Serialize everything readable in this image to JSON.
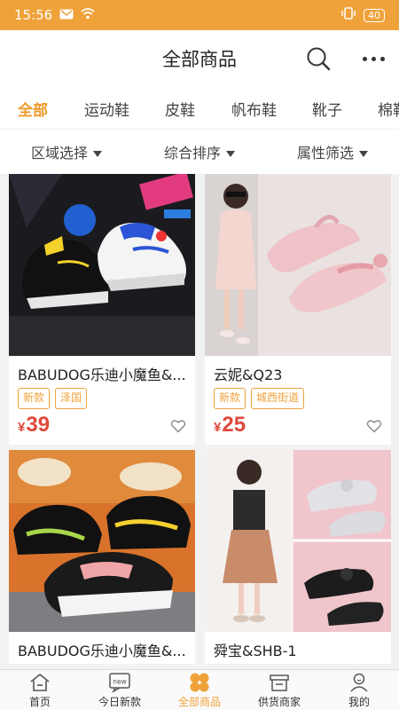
{
  "status_bar": {
    "time": "15:56",
    "battery": "40"
  },
  "header": {
    "title": "全部商品"
  },
  "categories": [
    {
      "label": "全部",
      "active": true
    },
    {
      "label": "运动鞋"
    },
    {
      "label": "皮鞋"
    },
    {
      "label": "帆布鞋"
    },
    {
      "label": "靴子"
    },
    {
      "label": "棉鞋"
    }
  ],
  "filters": [
    {
      "label": "区域选择"
    },
    {
      "label": "综合排序"
    },
    {
      "label": "属性筛选"
    }
  ],
  "products": [
    {
      "name": "BABUDOG乐迪小魔鱼&...",
      "tags": [
        "新款",
        "泽国"
      ],
      "currency": "¥",
      "price": "39"
    },
    {
      "name": "云妮&Q23",
      "tags": [
        "新款",
        "城西街道"
      ],
      "currency": "¥",
      "price": "25"
    },
    {
      "name": "BABUDOG乐迪小魔鱼&..."
    },
    {
      "name": "舜宝&SHB-1"
    }
  ],
  "tabbar": [
    {
      "label": "首页"
    },
    {
      "label": "今日新款",
      "badge": "new"
    },
    {
      "label": "全部商品",
      "active": true
    },
    {
      "label": "供货商家"
    },
    {
      "label": "我的"
    }
  ],
  "colors": {
    "accent": "#f0a23a",
    "price": "#e0483c"
  }
}
